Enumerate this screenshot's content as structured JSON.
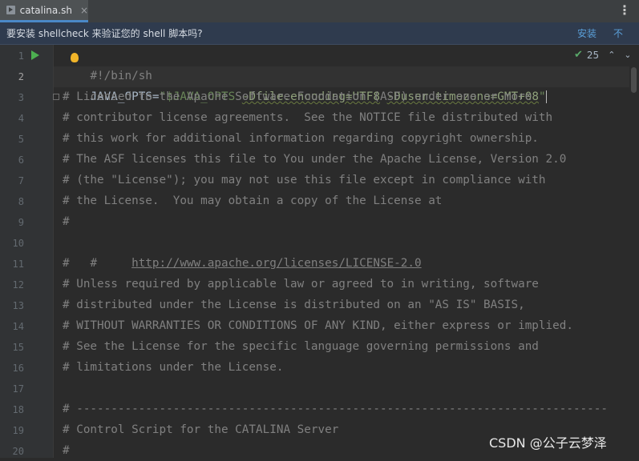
{
  "tab": {
    "label": "catalina.sh",
    "close": "×"
  },
  "menu_glyph": "⋮",
  "banner": {
    "message": "要安装 shellcheck 来验证您的 shell 脚本吗?",
    "install": "安装",
    "dismiss": "不"
  },
  "inspections": {
    "count": "25",
    "up": "⌃",
    "down": "⌄"
  },
  "line_numbers": [
    "1",
    "2",
    "3",
    "4",
    "5",
    "6",
    "7",
    "8",
    "9",
    "10",
    "11",
    "12",
    "13",
    "14",
    "15",
    "16",
    "17",
    "18",
    "19",
    "20"
  ],
  "code": {
    "line1": {
      "shebang_a": "#",
      "shebang_b": "!/bin/sh"
    },
    "line2": {
      "var": "JAVA_OPTS=",
      "str_open": "\"$JAVA_OPTS ",
      "flag1": "-Dfile.encoding=UTF8",
      "space": " ",
      "flag2": "-Duser.timezone=GMT+08",
      "str_close": "\""
    },
    "line3": "# Licensed to the Apache Software Foundation (ASF) under one or more",
    "line4": "# contributor license agreements.  See the NOTICE file distributed with",
    "line5": "# this work for additional information regarding copyright ownership.",
    "line6": "# The ASF licenses this file to You under the Apache License, Version 2.0",
    "line7": "# (the \"License\"); you may not use this file except in compliance with",
    "line8": "# the License.  You may obtain a copy of the License at",
    "line9": "#",
    "line10_prefix": "#     ",
    "line10_link": "http://www.apache.org/licenses/LICENSE-2.0",
    "line11": "#",
    "line12": "# Unless required by applicable law or agreed to in writing, software",
    "line13": "# distributed under the License is distributed on an \"AS IS\" BASIS,",
    "line14": "# WITHOUT WARRANTIES OR CONDITIONS OF ANY KIND, either express or implied.",
    "line15": "# See the License for the specific language governing permissions and",
    "line16": "# limitations under the License.",
    "line17": "",
    "line18": "# -----------------------------------------------------------------------------",
    "line19": "# Control Script for the CATALINA Server",
    "line20": "#"
  },
  "watermark": "CSDN @公子云梦泽",
  "colors": {
    "comment": "#808080",
    "string": "#6a8759",
    "plain": "#a9b7c6",
    "accent": "#4a88c7",
    "run": "#4caf50"
  }
}
